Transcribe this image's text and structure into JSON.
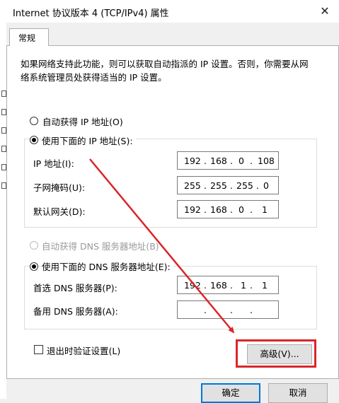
{
  "window": {
    "title": "Internet 协议版本 4 (TCP/IPv4) 属性",
    "close_glyph": "✕"
  },
  "tabs": [
    {
      "label": "常规"
    }
  ],
  "description": {
    "line1": "如果网络支持此功能，则可以获取自动指派的 IP 设置。否则，你需要从网",
    "line2": "络系统管理员处获得适当的 IP 设置。"
  },
  "ip": {
    "auto_label": "自动获得 IP 地址(O)",
    "manual_label": "使用下面的 IP 地址(S):",
    "selected": "manual",
    "fields": [
      {
        "label": "IP 地址(I):",
        "octets": [
          "192",
          "168",
          "0",
          "108"
        ]
      },
      {
        "label": "子网掩码(U):",
        "octets": [
          "255",
          "255",
          "255",
          "0"
        ]
      },
      {
        "label": "默认网关(D):",
        "octets": [
          "192",
          "168",
          "0",
          "1"
        ]
      }
    ]
  },
  "dns": {
    "auto_label": "自动获得 DNS 服务器地址(B)",
    "manual_label": "使用下面的 DNS 服务器地址(E):",
    "selected": "manual",
    "fields": [
      {
        "label": "首选 DNS 服务器(P):",
        "octets": [
          "192",
          "168",
          "1",
          "1"
        ]
      },
      {
        "label": "备用 DNS 服务器(A):",
        "octets": [
          "",
          "",
          "",
          ""
        ]
      }
    ]
  },
  "validate_checkbox": {
    "label": "退出时验证设置(L)",
    "checked": false
  },
  "buttons": {
    "advanced": "高级(V)...",
    "ok": "确定",
    "cancel": "取消"
  },
  "dot": ".",
  "colors": {
    "annotation": "#d9262a",
    "focus": "#0078d7"
  }
}
